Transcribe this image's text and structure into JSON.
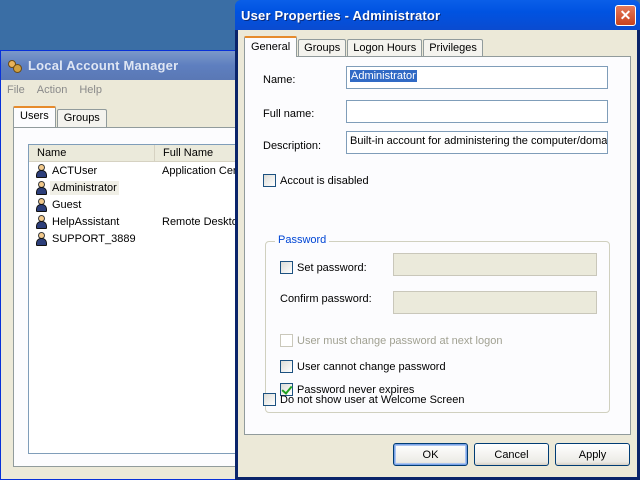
{
  "background_window": {
    "title": "Local Account Manager",
    "menu": [
      "File",
      "Action",
      "Help"
    ],
    "tabs": [
      "Users",
      "Groups"
    ],
    "columns": [
      "Name",
      "Full Name"
    ],
    "users": [
      {
        "name": "ACTUser",
        "full_name": "Application Cen"
      },
      {
        "name": "Administrator",
        "full_name": ""
      },
      {
        "name": "Guest",
        "full_name": ""
      },
      {
        "name": "HelpAssistant",
        "full_name": "Remote Desktop"
      },
      {
        "name": "SUPPORT_3889",
        "full_name": ""
      }
    ]
  },
  "dialog": {
    "title": "User Properties - Administrator",
    "close_glyph": "✕",
    "tabs": [
      "General",
      "Groups",
      "Logon Hours",
      "Privileges"
    ],
    "fields": {
      "name_label": "Name:",
      "name_value": "Administrator",
      "fullname_label": "Full name:",
      "fullname_value": "",
      "description_label": "Description:",
      "description_value": "Built-in account for administering the computer/domain"
    },
    "account_disabled_label": "Accout is disabled",
    "password_group": {
      "legend": "Password",
      "set_password_label": "Set password:",
      "confirm_password_label": "Confirm password:",
      "must_change_label": "User must change password at next logon",
      "cannot_change_label": "User cannot change password",
      "never_expires_label": "Password never expires"
    },
    "hide_welcome_label": "Do not show user at Welcome Screen",
    "buttons": {
      "ok": "OK",
      "cancel": "Cancel",
      "apply": "Apply"
    }
  }
}
